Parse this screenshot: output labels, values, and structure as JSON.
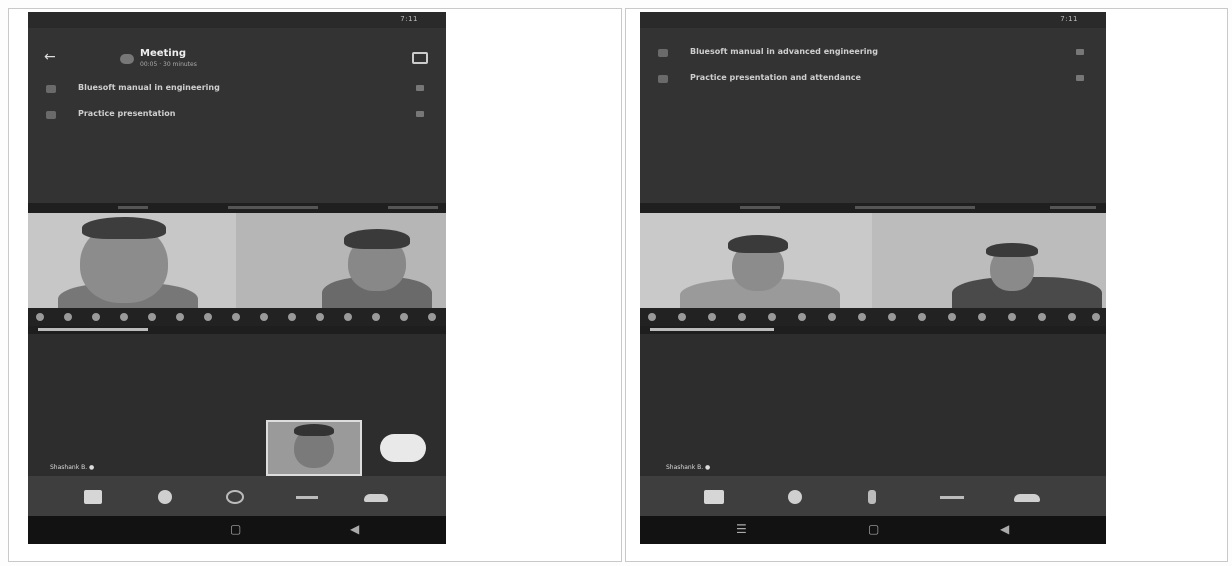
{
  "screens": [
    {
      "status": {
        "time": "7:11"
      },
      "header": {
        "title": "Meeting",
        "subtitle": "00:05 · 30 minutes",
        "messages": [
          {
            "text": "Bluesoft manual in engineering"
          },
          {
            "text": "Practice presentation"
          }
        ]
      },
      "self_name": "Shashank B. ●"
    },
    {
      "status": {
        "time": "7:11"
      },
      "header": {
        "messages": [
          {
            "text": "Bluesoft manual in advanced engineering"
          },
          {
            "text": "Practice presentation and attendance"
          }
        ]
      },
      "self_name": "Shashank B. ●"
    }
  ],
  "icons": {
    "controls": [
      "video-icon",
      "mic-icon",
      "speaker-icon",
      "more-icon",
      "hang-up-icon"
    ],
    "nav": [
      "recent-apps-icon",
      "home-icon",
      "back-icon"
    ]
  }
}
